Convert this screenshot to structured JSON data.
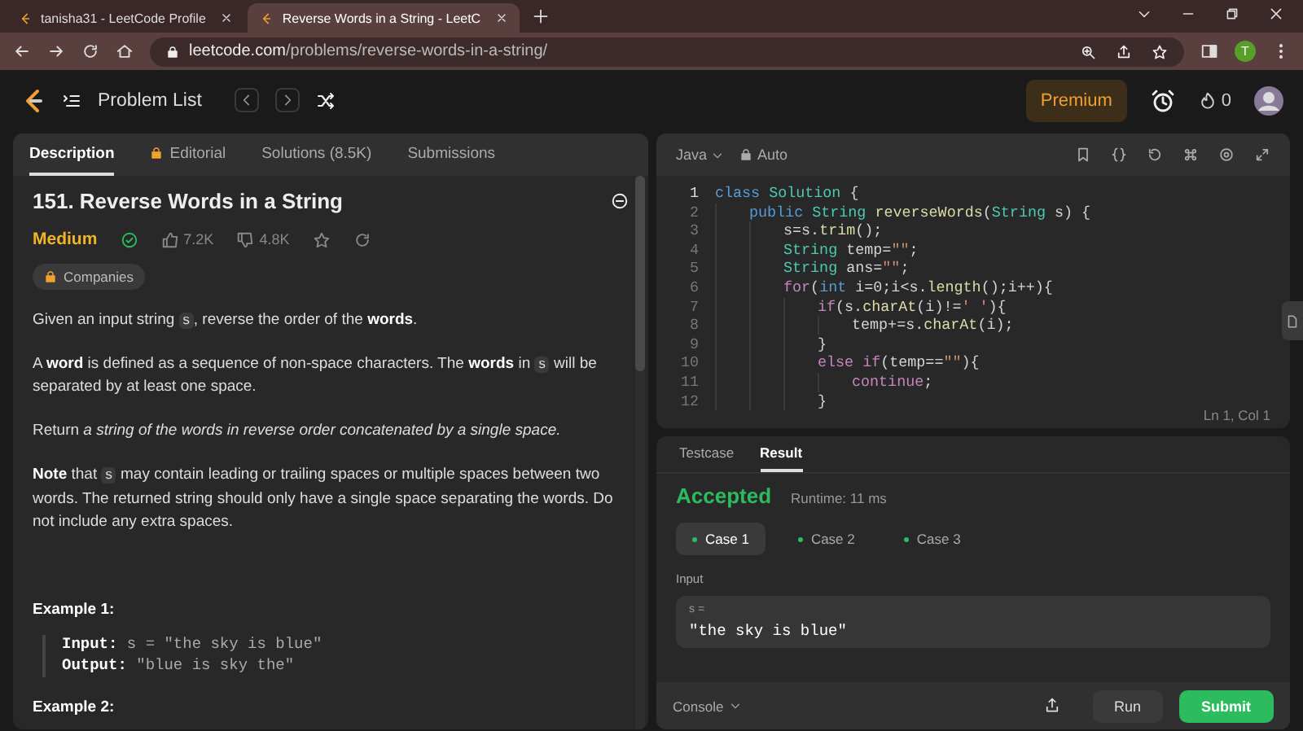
{
  "browser": {
    "tabs": [
      {
        "title": "tanisha31 - LeetCode Profile",
        "selected": false
      },
      {
        "title": "Reverse Words in a String - LeetC",
        "selected": true
      }
    ],
    "url_host": "leetcode.com",
    "url_path": "/problems/reverse-words-in-a-string/",
    "profile_initial": "T"
  },
  "nav": {
    "problem_list": "Problem List",
    "premium": "Premium",
    "streak": "0"
  },
  "description": {
    "tabs": [
      {
        "label": "Description",
        "selected": true,
        "locked": false
      },
      {
        "label": "Editorial",
        "selected": false,
        "locked": true
      },
      {
        "label": "Solutions (8.5K)",
        "selected": false,
        "locked": false
      },
      {
        "label": "Submissions",
        "selected": false,
        "locked": false
      }
    ],
    "title": "151. Reverse Words in a String",
    "difficulty": "Medium",
    "solved": true,
    "likes": "7.2K",
    "dislikes": "4.8K",
    "companies": "Companies",
    "paragraphs": [
      [
        {
          "kind": "text",
          "text": "Given an input string "
        },
        {
          "kind": "code",
          "text": "s"
        },
        {
          "kind": "text",
          "text": ", reverse the order of the **words**."
        }
      ],
      [
        {
          "kind": "text",
          "text": "A **word** is defined as a sequence of non-space characters. The **words** in "
        },
        {
          "kind": "code",
          "text": "s"
        },
        {
          "kind": "text",
          "text": " will be separated by at least one space."
        }
      ],
      [
        {
          "kind": "text",
          "text": "Return *a string of the words in reverse order concatenated by a single space.*"
        }
      ],
      [
        {
          "kind": "text",
          "text": "**Note** that "
        },
        {
          "kind": "code",
          "text": "s"
        },
        {
          "kind": "text",
          "text": " may contain leading or trailing spaces or multiple spaces between two words. The returned string should only have a single space separating the words. Do not include any extra spaces."
        }
      ]
    ],
    "examples": [
      {
        "title": "Example 1:",
        "input_label": "Input:",
        "input": "s = \"the sky is blue\"",
        "output_label": "Output:",
        "output": "\"blue is sky the\""
      },
      {
        "title": "Example 2:"
      }
    ]
  },
  "editor": {
    "language": "Java",
    "mode": "Auto",
    "cursor": "Ln 1, Col 1",
    "lines": [
      {
        "number": "1",
        "tokens": [
          {
            "kind": "kw",
            "text": "class"
          },
          {
            "kind": "type",
            "text": " Solution"
          },
          {
            "kind": "p",
            "text": " {"
          }
        ],
        "children": [
          {
            "number": "2",
            "tokens": [
              {
                "kind": "kw",
                "text": "public"
              },
              {
                "kind": "type",
                "text": " String"
              },
              {
                "kind": "fn",
                "text": " reverseWords"
              },
              {
                "kind": "p",
                "text": "("
              },
              {
                "kind": "type",
                "text": "String"
              },
              {
                "kind": "p",
                "text": " s) {"
              }
            ],
            "children": [
              {
                "number": "3",
                "tokens": [
                  {
                    "kind": "p",
                    "text": "s=s."
                  },
                  {
                    "kind": "fn",
                    "text": "trim"
                  },
                  {
                    "kind": "p",
                    "text": "();"
                  }
                ]
              },
              {
                "number": "4",
                "tokens": [
                  {
                    "kind": "type",
                    "text": "String"
                  },
                  {
                    "kind": "p",
                    "text": " temp="
                  },
                  {
                    "kind": "str",
                    "text": "\"\""
                  },
                  {
                    "kind": "p",
                    "text": ";"
                  }
                ]
              },
              {
                "number": "5",
                "tokens": [
                  {
                    "kind": "type",
                    "text": "String"
                  },
                  {
                    "kind": "p",
                    "text": " ans="
                  },
                  {
                    "kind": "str",
                    "text": "\"\""
                  },
                  {
                    "kind": "p",
                    "text": ";"
                  }
                ]
              },
              {
                "number": "6",
                "tokens": [
                  {
                    "kind": "ctl",
                    "text": "for"
                  },
                  {
                    "kind": "p",
                    "text": "("
                  },
                  {
                    "kind": "kw",
                    "text": "int"
                  },
                  {
                    "kind": "p",
                    "text": " i=0;i<s."
                  },
                  {
                    "kind": "fn",
                    "text": "length"
                  },
                  {
                    "kind": "p",
                    "text": "();i++){"
                  }
                ],
                "children": [
                  {
                    "number": "7",
                    "tokens": [
                      {
                        "kind": "ctl",
                        "text": "if"
                      },
                      {
                        "kind": "p",
                        "text": "(s."
                      },
                      {
                        "kind": "fn",
                        "text": "charAt"
                      },
                      {
                        "kind": "p",
                        "text": "(i)!="
                      },
                      {
                        "kind": "str",
                        "text": "' '"
                      },
                      {
                        "kind": "p",
                        "text": "){"
                      }
                    ],
                    "children": [
                      {
                        "number": "8",
                        "tokens": [
                          {
                            "kind": "p",
                            "text": "temp+=s."
                          },
                          {
                            "kind": "fn",
                            "text": "charAt"
                          },
                          {
                            "kind": "p",
                            "text": "(i);"
                          }
                        ]
                      }
                    ]
                  },
                  {
                    "number": "9",
                    "tokens": [
                      {
                        "kind": "p",
                        "text": "}"
                      }
                    ]
                  },
                  {
                    "number": "10",
                    "tokens": [
                      {
                        "kind": "ctl",
                        "text": "else if"
                      },
                      {
                        "kind": "p",
                        "text": "(temp=="
                      },
                      {
                        "kind": "str",
                        "text": "\"\""
                      },
                      {
                        "kind": "p",
                        "text": "){"
                      }
                    ],
                    "children": [
                      {
                        "number": "11",
                        "tokens": [
                          {
                            "kind": "ctl",
                            "text": "continue"
                          },
                          {
                            "kind": "p",
                            "text": ";"
                          }
                        ]
                      }
                    ]
                  },
                  {
                    "number": "12",
                    "tokens": [
                      {
                        "kind": "p",
                        "text": "}"
                      }
                    ]
                  }
                ]
              }
            ]
          }
        ]
      }
    ]
  },
  "result": {
    "tabs": [
      {
        "label": "Testcase",
        "selected": false
      },
      {
        "label": "Result",
        "selected": true
      }
    ],
    "status": "Accepted",
    "runtime": "Runtime: 11 ms",
    "cases": [
      {
        "label": "Case 1",
        "selected": true
      },
      {
        "label": "Case 2",
        "selected": false
      },
      {
        "label": "Case 3",
        "selected": false
      }
    ],
    "input_label": "Input",
    "var_label": "s =",
    "value": "\"the sky is blue\"",
    "console": "Console",
    "run": "Run",
    "submit": "Submit"
  }
}
